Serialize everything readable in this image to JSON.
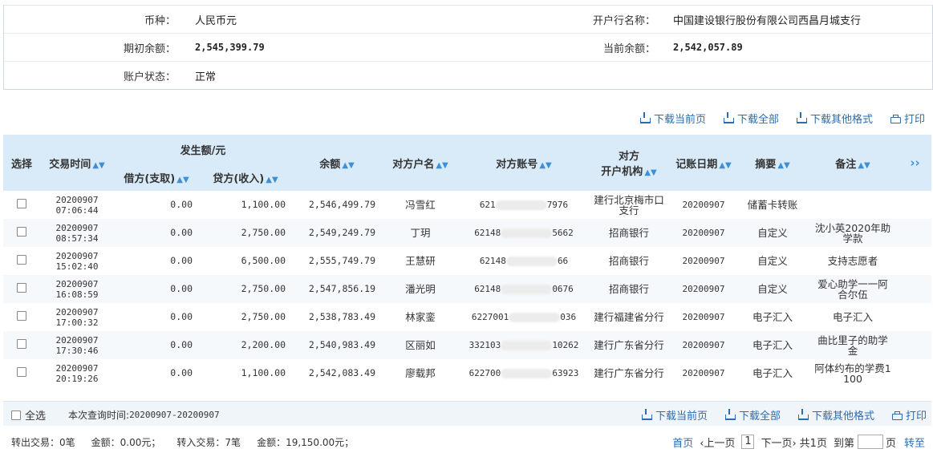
{
  "info": {
    "currency_label": "币种：",
    "currency_value": "人民币元",
    "bank_label": "开户行名称：",
    "bank_value": "中国建设银行股份有限公司西昌月城支行",
    "opening_balance_label": "期初余额：",
    "opening_balance_value": "2,545,399.79",
    "current_balance_label": "当前余额：",
    "current_balance_value": "2,542,057.89",
    "status_label": "账户状态：",
    "status_value": "正常"
  },
  "actions": {
    "download_page": "下载当前页",
    "download_all": "下载全部",
    "download_other": "下载其他格式",
    "print": "打印"
  },
  "table": {
    "headers": {
      "select": "选择",
      "time": "交易时间",
      "amount_group": "发生额/元",
      "debit": "借方(支取)",
      "credit": "贷方(收入)",
      "balance": "余额",
      "cp_name": "对方户名",
      "cp_account": "对方账号",
      "cp_bank_line1": "对方",
      "cp_bank_line2": "开户机构",
      "post_date": "记账日期",
      "summary": "摘要",
      "remark": "备注",
      "more": "››"
    },
    "rows": [
      {
        "date": "20200907",
        "time": "07:06:44",
        "debit": "0.00",
        "credit": "1,100.00",
        "balance": "2,546,499.79",
        "name": "冯雪红",
        "acct_pre": "621",
        "acct_suf": "7976",
        "bank": "建行北京梅市口支行",
        "post": "20200907",
        "summary": "储蓄卡转账",
        "remark": ""
      },
      {
        "date": "20200907",
        "time": "08:57:34",
        "debit": "0.00",
        "credit": "2,750.00",
        "balance": "2,549,249.79",
        "name": "丁玥",
        "acct_pre": "62148",
        "acct_suf": "5662",
        "bank": "招商银行",
        "post": "20200907",
        "summary": "自定义",
        "remark": "沈小英2020年助学款"
      },
      {
        "date": "20200907",
        "time": "15:02:40",
        "debit": "0.00",
        "credit": "6,500.00",
        "balance": "2,555,749.79",
        "name": "王慧研",
        "acct_pre": "62148",
        "acct_suf": "66",
        "bank": "招商银行",
        "post": "20200907",
        "summary": "自定义",
        "remark": "支持志愿者"
      },
      {
        "date": "20200907",
        "time": "16:08:59",
        "debit": "0.00",
        "credit": "2,750.00",
        "balance": "2,547,856.19",
        "name": "潘光明",
        "acct_pre": "62148",
        "acct_suf": "0676",
        "bank": "招商银行",
        "post": "20200907",
        "summary": "自定义",
        "remark": "爱心助学一一阿合尔伍"
      },
      {
        "date": "20200907",
        "time": "17:00:32",
        "debit": "0.00",
        "credit": "2,750.00",
        "balance": "2,538,783.49",
        "name": "林家銮",
        "acct_pre": "6227001",
        "acct_suf": "036",
        "bank": "建行福建省分行",
        "post": "20200907",
        "summary": "电子汇入",
        "remark": "电子汇入"
      },
      {
        "date": "20200907",
        "time": "17:30:46",
        "debit": "0.00",
        "credit": "2,200.00",
        "balance": "2,540,983.49",
        "name": "区丽如",
        "acct_pre": "332103",
        "acct_suf": "10262",
        "bank": "建行广东省分行",
        "post": "20200907",
        "summary": "电子汇入",
        "remark": "曲比里子的助学金"
      },
      {
        "date": "20200907",
        "time": "20:19:26",
        "debit": "0.00",
        "credit": "1,100.00",
        "balance": "2,542,083.49",
        "name": "廖载邦",
        "acct_pre": "622700",
        "acct_suf": "63923",
        "bank": "建行广东省分行",
        "post": "20200907",
        "summary": "电子汇入",
        "remark": "阿体约布的学费1100"
      }
    ]
  },
  "footer": {
    "select_all": "全选",
    "query_time_label": "本次查询时间:",
    "query_time_value": "20200907-20200907",
    "out_label": "转出交易：",
    "out_count": "0笔",
    "out_amount_label": "金额：",
    "out_amount": "0.00元；",
    "in_label": "转入交易：",
    "in_count": "7笔",
    "in_amount_label": "金额：",
    "in_amount": "19,150.00元；",
    "first": "首页",
    "prev": "‹上一页",
    "page": "1",
    "next": "下一页›",
    "total": "共1页",
    "goto_label": "到第",
    "goto_unit": "页",
    "goto_btn": "转至"
  }
}
